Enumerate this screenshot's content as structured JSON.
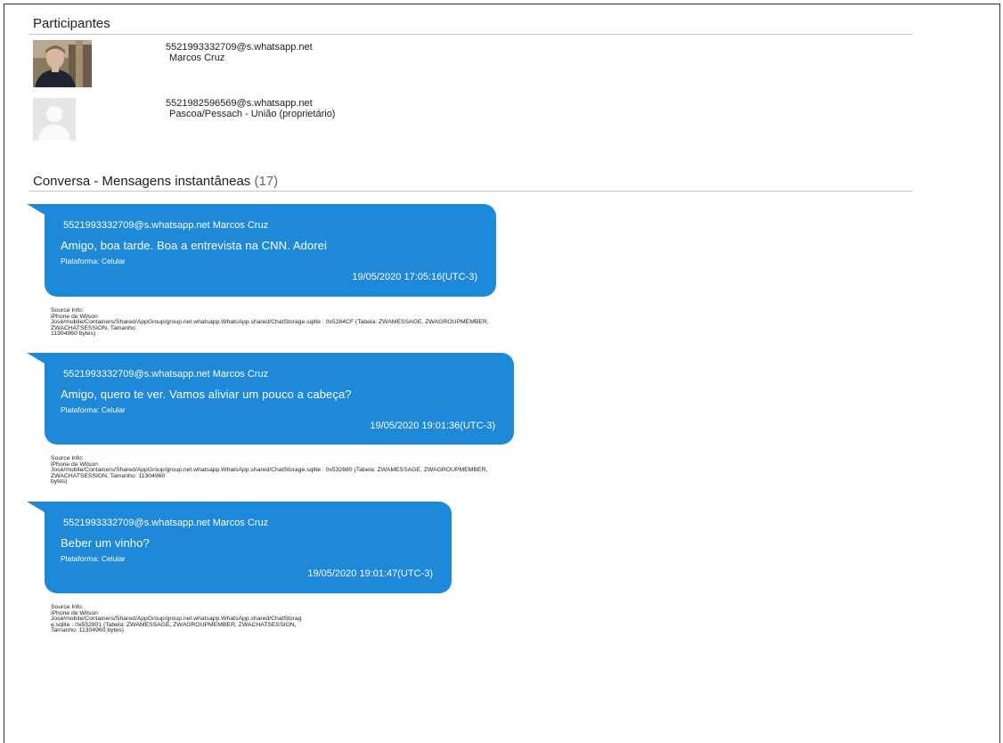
{
  "participants_section": {
    "title": "Participantes"
  },
  "participants": [
    {
      "id": "5521993332709@s.whatsapp.net",
      "name": "Marcos Cruz",
      "avatar_icon": "photo-avatar"
    },
    {
      "id": "5521982596569@s.whatsapp.net",
      "name": "Pascoa/Pessach - União (proprietário)",
      "avatar_icon": "default-user-icon"
    }
  ],
  "conversation_section": {
    "title": "Conversa - Mensagens instantâneas",
    "count": "(17)"
  },
  "messages": [
    {
      "sender": "5521993332709@s.whatsapp.net Marcos Cruz",
      "text": "Amigo, boa tarde. Boa a entrevista na CNN. Adorei",
      "platform": "Plataforma: Celular",
      "timestamp": "19/05/2020 17:05:16(UTC-3)",
      "source": "Source Info:\niPhone de Wilson\nJosé/mobile/Containers/Shared/AppGroup/group.net.whatsapp.WhatsApp.shared/ChatStorage.sqlite : 0x5284CF (Tabela: ZWAMESSAGE, ZWAGROUPMEMBER, ZWACHATSESSION, Tamanho:\n11304960 bytes)"
    },
    {
      "sender": "5521993332709@s.whatsapp.net Marcos Cruz",
      "text": "Amigo, quero te ver. Vamos aliviar um pouco a cabeça?",
      "platform": "Plataforma: Celular",
      "timestamp": "19/05/2020 19:01:36(UTC-3)",
      "source": "Source Info:\niPhone de Wilson\nJosé/mobile/Containers/Shared/AppGroup/group.net.whatsapp.WhatsApp.shared/ChatStorage.sqlite : 0x532680 (Tabela: ZWAMESSAGE, ZWAGROUPMEMBER, ZWACHATSESSION, Tamanho: 11304960\nbytes)"
    },
    {
      "sender": "5521993332709@s.whatsapp.net Marcos Cruz",
      "text": "Beber um vinho?",
      "platform": "Plataforma: Celular",
      "timestamp": "19/05/2020 19:01:47(UTC-3)",
      "source": "Source Info:\niPhone de Wilson\nJosé/mobile/Containers/Shared/AppGroup/group.net.whatsapp.WhatsApp.shared/ChatStorag\ne.sqlite : 0x532801 (Tabela: ZWAMESSAGE, ZWAGROUPMEMBER, ZWACHATSESSION,\nTamanho: 11304960 bytes)"
    }
  ],
  "colors": {
    "bubble": "#1e88d9",
    "rule": "#b9c6dc"
  }
}
